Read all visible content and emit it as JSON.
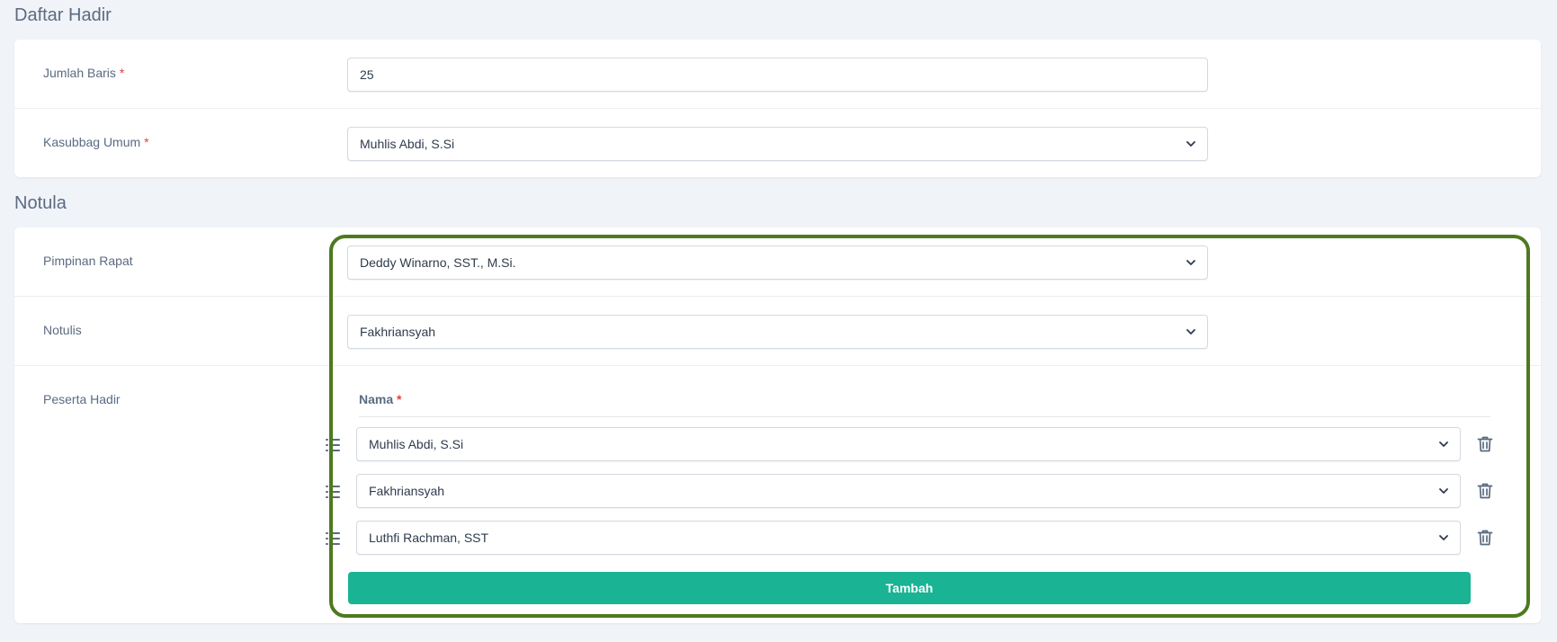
{
  "sections": {
    "daftar_hadir": "Daftar Hadir",
    "notula": "Notula"
  },
  "daftar_hadir": {
    "jumlah_baris_label": "Jumlah Baris",
    "jumlah_baris_value": "25",
    "kasubbag_label": "Kasubbag Umum",
    "kasubbag_value": "Muhlis Abdi, S.Si"
  },
  "notula": {
    "pimpinan_label": "Pimpinan Rapat",
    "pimpinan_value": "Deddy Winarno, SST., M.Si.",
    "notulis_label": "Notulis",
    "notulis_value": "Fakhriansyah",
    "peserta_label": "Peserta Hadir",
    "peserta_column_header": "Nama",
    "peserta": [
      "Muhlis Abdi, S.Si",
      "Fakhriansyah",
      "Luthfi Rachman, SST"
    ],
    "add_button": "Tambah"
  },
  "required_marker": "*",
  "colors": {
    "accent": "#1ab394",
    "highlight": "#4d7a1f",
    "required": "#e53e3e"
  },
  "icons": {
    "select": "chevron-down-icon",
    "drag": "drag-handle-icon",
    "delete": "trash-icon"
  }
}
